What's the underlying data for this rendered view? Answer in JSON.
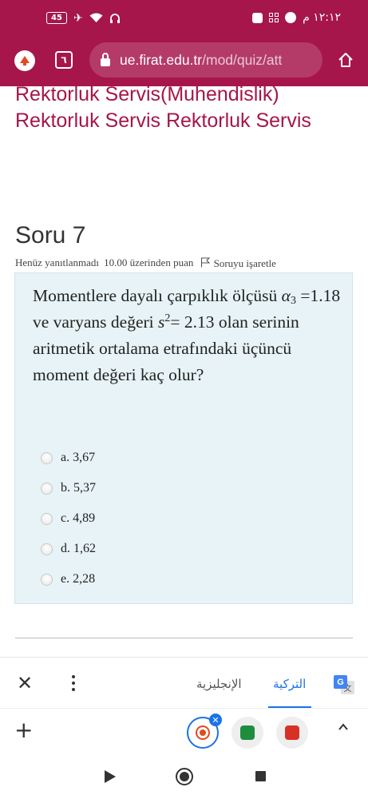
{
  "status_bar": {
    "battery": "45",
    "time": "١٢:١٢ م"
  },
  "browser": {
    "tab_count": "٦",
    "url_host": "ue.firat.edu.tr",
    "url_path": "/mod/quiz/att"
  },
  "page": {
    "category_line1": "Rektorluk Servis(Muhendislik)",
    "category_line2": "Rektorluk Servis Rektorluk Servis",
    "question_title": "Soru 7",
    "status_text": "Henüz yanıtlanmadı",
    "points_text": "10.00 üzerinden puan",
    "flag_text": "Soruyu işaretle",
    "question": {
      "part1": "Momentlere dayalı çarpıklık ölçüsü",
      "alpha_symbol": "α",
      "alpha_sub": "3",
      "part2": "=1.18 ve varyans değeri",
      "s_symbol": "s",
      "s_sup": "2",
      "part3": "= 2.13",
      "part4": "olan serinin aritmetik ortalama etrafındaki üçüncü moment değeri kaç olur?"
    },
    "answers": [
      {
        "label": "a. 3,67"
      },
      {
        "label": "b. 5,37"
      },
      {
        "label": "c. 4,89"
      },
      {
        "label": "d. 1,62"
      },
      {
        "label": "e. 2,28"
      }
    ]
  },
  "translate_bar": {
    "lang_english": "الإنجليزية",
    "lang_turkish": "التركية",
    "selected": "التركية"
  },
  "colors": {
    "brand": "#a6164a",
    "question_bg": "#e7f3f6",
    "accent": "#1a73e8"
  },
  "icons": {
    "status": [
      "battery-icon",
      "airplane-icon",
      "wifi-icon",
      "headphones-icon",
      "sim-icon",
      "qr-icon",
      "whatsapp-icon"
    ],
    "browser": [
      "home-icon",
      "lock-icon",
      "up-arrow-icon"
    ],
    "bottom": [
      "close-icon",
      "more-icon",
      "google-translate-icon",
      "plus-icon",
      "chevron-up-icon"
    ],
    "nav": [
      "back-icon",
      "home-nav-icon",
      "recents-icon"
    ]
  }
}
